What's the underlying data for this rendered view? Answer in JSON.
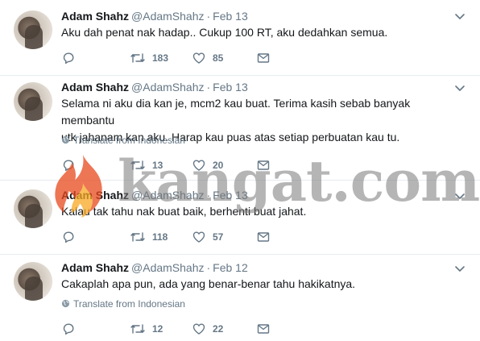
{
  "tweets": [
    {
      "name": "Adam Shahz",
      "handle": "@AdamShahz",
      "separator": "·",
      "date": "Feb 13",
      "text": "Aku dah penat nak hadap.. Cukup 100 RT, aku dedahkan semua.",
      "translate": "",
      "retweets": "183",
      "likes": "85"
    },
    {
      "name": "Adam Shahz",
      "handle": "@AdamShahz",
      "separator": "·",
      "date": "Feb 13",
      "text_line1": "Selama ni aku dia kan je, mcm2 kau buat. Terima kasih sebab banyak membantu",
      "text_line2": "utk jahanam kan aku. Harap kau puas atas setiap perbuatan kau tu.",
      "translate": "Translate from Indonesian",
      "retweets": "13",
      "likes": "20"
    },
    {
      "name": "Adam Shahz",
      "handle": "@AdamShahz",
      "separator": "·",
      "date": "Feb 13",
      "text": "Kalau tak tahu nak buat baik, berhenti buat jahat.",
      "translate": "",
      "retweets": "118",
      "likes": "57"
    },
    {
      "name": "Adam Shahz",
      "handle": "@AdamShahz",
      "separator": "·",
      "date": "Feb 12",
      "text": "Cakaplah apa pun, ada yang benar-benar tahu hakikatnya.",
      "translate": "Translate from Indonesian",
      "retweets": "12",
      "likes": "22"
    }
  ],
  "watermark": {
    "text": "kangat.com"
  },
  "icons": {
    "reply": "reply-icon",
    "retweet": "retweet-icon",
    "like": "heart-icon",
    "dm": "envelope-icon",
    "menu": "chevron-down-icon",
    "translate": "globe-icon"
  },
  "colors": {
    "text": "#14171a",
    "secondary": "#657786",
    "divider": "#e6ecf0",
    "icon": "#657786"
  }
}
